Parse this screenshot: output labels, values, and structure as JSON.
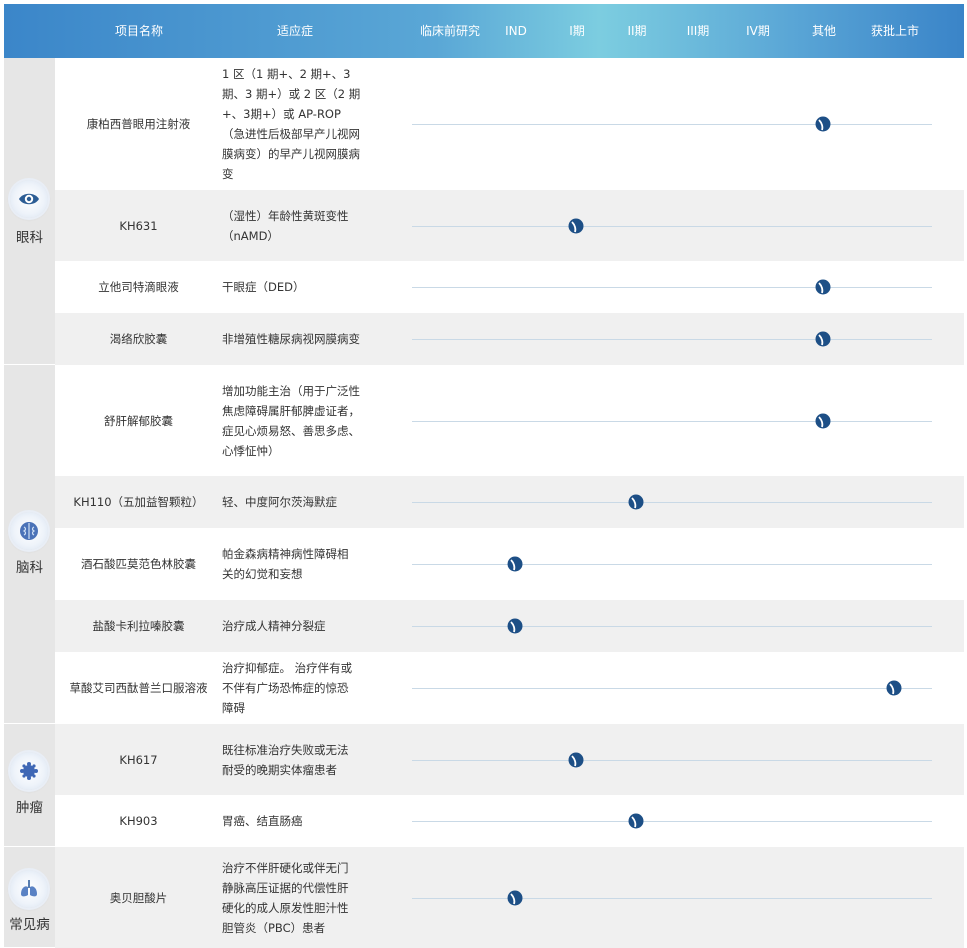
{
  "header": {
    "name": "项目名称",
    "indication": "适应症",
    "preclinical": "临床前研究",
    "ind": "IND",
    "phase1": "I期",
    "phase2": "II期",
    "phase3": "III期",
    "phase4": "IV期",
    "other": "其他",
    "approved": "获批上市"
  },
  "colors": {
    "marker": "#1d4f86",
    "category_bg": "#e6e6e6",
    "row_alt_bg": "#f0f0f0",
    "line": "#c9d9e6"
  },
  "categories": [
    {
      "label": "眼科",
      "icon": "eye-icon"
    },
    {
      "label": "脑科",
      "icon": "brain-icon"
    },
    {
      "label": "肿瘤",
      "icon": "tumor-icon"
    },
    {
      "label": "常见病",
      "icon": "lungs-icon"
    }
  ],
  "rows": [
    {
      "name": "康柏西普眼用注射液",
      "indication": "1 区（1 期+、2 期+、3 期、3 期+）或 2 区（2 期+、3期+）或 AP-ROP（急进性后极部早产儿视网膜病变）的早产儿视网膜病变",
      "stage": "其他"
    },
    {
      "name": "KH631",
      "indication": "（湿性）年龄性黄斑变性（nAMD）",
      "stage": "I期"
    },
    {
      "name": "立他司特滴眼液",
      "indication": "干眼症（DED）",
      "stage": "其他"
    },
    {
      "name": "渴络欣胶囊",
      "indication": "非增殖性糖尿病视网膜病变",
      "stage": "其他"
    },
    {
      "name": "舒肝解郁胶囊",
      "indication": "增加功能主治（用于广泛性焦虑障碍属肝郁脾虚证者，症见心烦易怒、善思多虑、心悸怔忡）",
      "stage": "其他"
    },
    {
      "name": "KH110（五加益智颗粒）",
      "indication": "轻、中度阿尔茨海默症",
      "stage": "II期"
    },
    {
      "name": "酒石酸匹莫范色林胶囊",
      "indication": "帕金森病精神病性障碍相 关的幻觉和妄想",
      "stage": "IND"
    },
    {
      "name": "盐酸卡利拉嗪胶囊",
      "indication": "治疗成人精神分裂症",
      "stage": "IND"
    },
    {
      "name": "草酸艾司西酞普兰口服溶液",
      "indication": "治疗抑郁症。 治疗伴有或 不伴有广场恐怖症的惊恐 障碍",
      "stage": "获批上市"
    },
    {
      "name": "KH617",
      "indication": "既往标准治疗失败或无法 耐受的晚期实体瘤患者",
      "stage": "I期"
    },
    {
      "name": "KH903",
      "indication": "胃癌、结直肠癌",
      "stage": "II期"
    },
    {
      "name": "奥贝胆酸片",
      "indication": "治疗不伴肝硬化或伴无门 静脉高压证据的代偿性肝 硬化的成人原发性胆汁性 胆管炎（PBC）患者",
      "stage": "IND"
    }
  ]
}
